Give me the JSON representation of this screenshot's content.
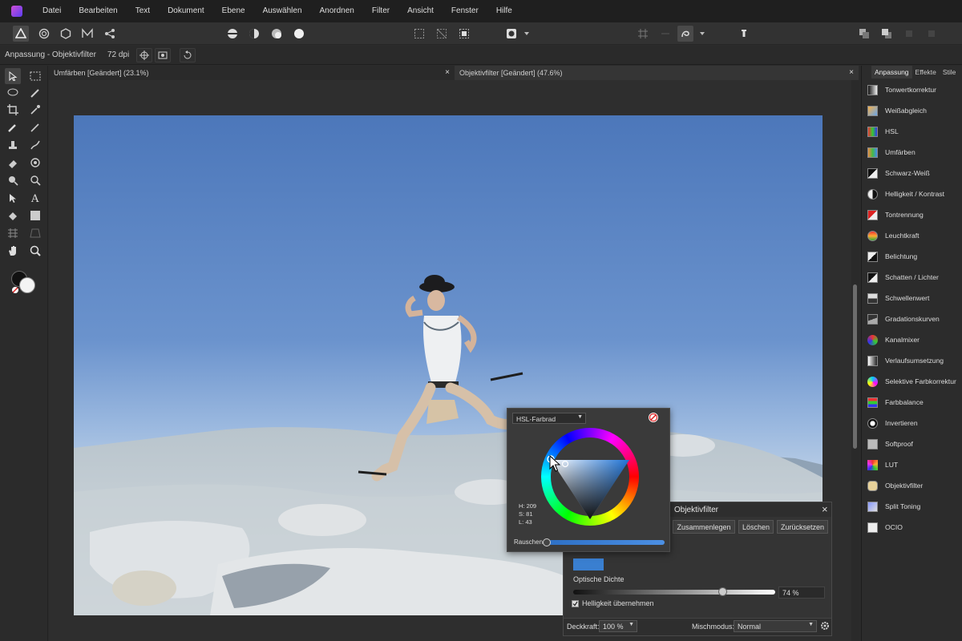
{
  "menubar": {
    "items": [
      "Datei",
      "Bearbeiten",
      "Text",
      "Dokument",
      "Ebene",
      "Auswählen",
      "Anordnen",
      "Filter",
      "Ansicht",
      "Fenster",
      "Hilfe"
    ]
  },
  "context": {
    "label": "Anpassung - Objektivfilter",
    "dpi": "72 dpi"
  },
  "tabs": [
    {
      "label": "Umfärben [Geändert] (23.1%)",
      "close": "×"
    },
    {
      "label": "Objektivfilter [Geändert] (47.6%)",
      "close": "×"
    }
  ],
  "right_panel": {
    "tabs": [
      "Anpassung",
      "Effekte",
      "Stile"
    ],
    "items": [
      {
        "label": "Tonwertkorrektur",
        "icon": "levels-icon"
      },
      {
        "label": "Weißabgleich",
        "icon": "white-balance-icon"
      },
      {
        "label": "HSL",
        "icon": "hsl-icon"
      },
      {
        "label": "Umfärben",
        "icon": "recolor-icon"
      },
      {
        "label": "Schwarz-Weiß",
        "icon": "black-white-icon"
      },
      {
        "label": "Helligkeit / Kontrast",
        "icon": "brightness-contrast-icon"
      },
      {
        "label": "Tontrennung",
        "icon": "posterize-icon"
      },
      {
        "label": "Leuchtkraft",
        "icon": "vibrance-icon"
      },
      {
        "label": "Belichtung",
        "icon": "exposure-icon"
      },
      {
        "label": "Schatten / Lichter",
        "icon": "shadows-highlights-icon"
      },
      {
        "label": "Schwellenwert",
        "icon": "threshold-icon"
      },
      {
        "label": "Gradationskurven",
        "icon": "curves-icon"
      },
      {
        "label": "Kanalmixer",
        "icon": "channel-mixer-icon"
      },
      {
        "label": "Verlaufsumsetzung",
        "icon": "gradient-map-icon"
      },
      {
        "label": "Selektive Farbkorrektur",
        "icon": "selective-color-icon"
      },
      {
        "label": "Farbbalance",
        "icon": "color-balance-icon"
      },
      {
        "label": "Invertieren",
        "icon": "invert-icon"
      },
      {
        "label": "Softproof",
        "icon": "softproof-icon"
      },
      {
        "label": "LUT",
        "icon": "lut-icon"
      },
      {
        "label": "Objektivfilter",
        "icon": "lens-filter-icon"
      },
      {
        "label": "Split Toning",
        "icon": "split-toning-icon"
      },
      {
        "label": "OCIO",
        "icon": "ocio-icon"
      }
    ]
  },
  "color_popup": {
    "mode": "HSL-Farbrad",
    "h": "H: 209",
    "s": "S: 81",
    "l": "L: 43",
    "noise_label": "Rauschen"
  },
  "objektivfilter": {
    "title": "Objektivfilter",
    "close": "×",
    "buttons": [
      "Zusammenlegen",
      "Löschen",
      "Zurücksetzen"
    ],
    "swatch_color": "#3a7fd0",
    "density_label": "Optische Dichte",
    "density_value": "74 %",
    "density_level": 0.74,
    "checkbox_label": "Helligkeit übernehmen",
    "checkbox_checked": true,
    "opacity_label": "Deckkraft:",
    "opacity_value": "100 %",
    "blend_label": "Mischmodus:",
    "blend_value": "Normal"
  }
}
